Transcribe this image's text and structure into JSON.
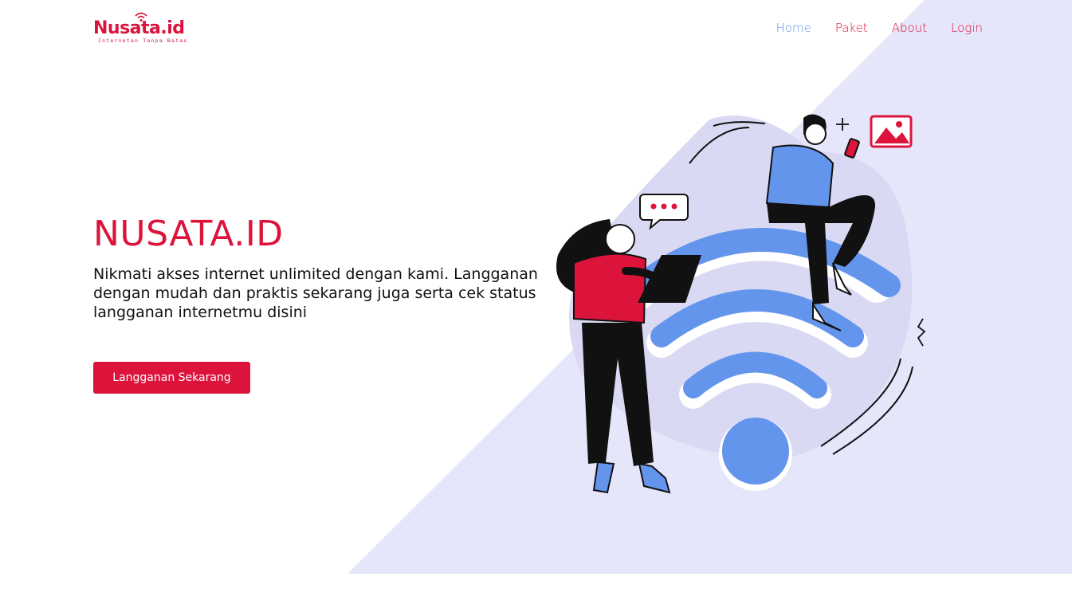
{
  "brand": {
    "logo_text": "Nusata.id",
    "tagline": "Internetan Tanpa Batas",
    "primary_color": "#dc143c",
    "accent_color": "#6495ed",
    "background_shape_color": "#e6e6fa"
  },
  "nav": {
    "items": [
      {
        "label": "Home",
        "active": true
      },
      {
        "label": "Paket",
        "active": false
      },
      {
        "label": "About",
        "active": false
      },
      {
        "label": "Login",
        "active": false
      }
    ]
  },
  "hero": {
    "title": "NUSATA.ID",
    "description": "Nikmati akses internet unlimited dengan kami. Langganan dengan mudah dan praktis sekarang juga serta cek status langganan internetmu disini",
    "cta_label": "Langganan Sekarang"
  },
  "illustration": {
    "subject": "wifi-people-illustration",
    "icons": [
      "wifi-icon",
      "chat-bubble-icon",
      "image-icon",
      "sparkle-icon"
    ]
  }
}
